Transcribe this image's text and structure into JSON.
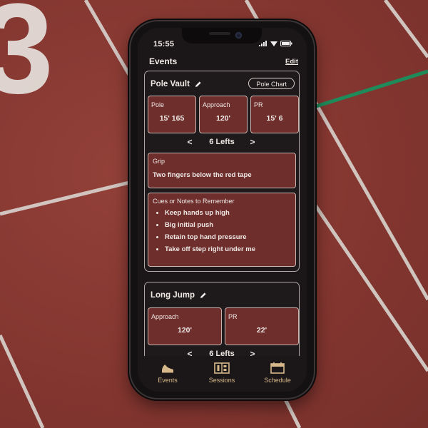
{
  "background": {
    "lane_number": "3"
  },
  "status_bar": {
    "time": "15:55"
  },
  "header": {
    "title": "Events",
    "edit_label": "Edit"
  },
  "events": [
    {
      "title": "Pole Vault",
      "chart_button": "Pole Chart",
      "stats": [
        {
          "label": "Pole",
          "value": "15' 165"
        },
        {
          "label": "Approach",
          "value": "120'"
        },
        {
          "label": "PR",
          "value": "15' 6"
        }
      ],
      "stepper": {
        "prev": "<",
        "label": "6 Lefts",
        "next": ">"
      },
      "grip": {
        "label": "Grip",
        "text": "Two fingers below the red tape"
      },
      "cues": {
        "label": "Cues or Notes to Remember",
        "items": [
          "Keep hands up high",
          "Big initial push",
          "Retain top hand pressure",
          "Take off step right under me"
        ]
      }
    },
    {
      "title": "Long Jump",
      "stats": [
        {
          "label": "Approach",
          "value": "120'"
        },
        {
          "label": "PR",
          "value": "22'"
        }
      ],
      "stepper": {
        "prev": "<",
        "label": "6 Lefts",
        "next": ">"
      }
    }
  ],
  "tabs": [
    {
      "label": "Events",
      "icon": "shoe-icon"
    },
    {
      "label": "Sessions",
      "icon": "scoreboard-icon"
    },
    {
      "label": "Schedule",
      "icon": "calendar-icon"
    }
  ],
  "colors": {
    "tile": "#6e2e2c",
    "accent": "#d7b88a",
    "screen": "#1b1718",
    "track": "#8a3a33"
  }
}
